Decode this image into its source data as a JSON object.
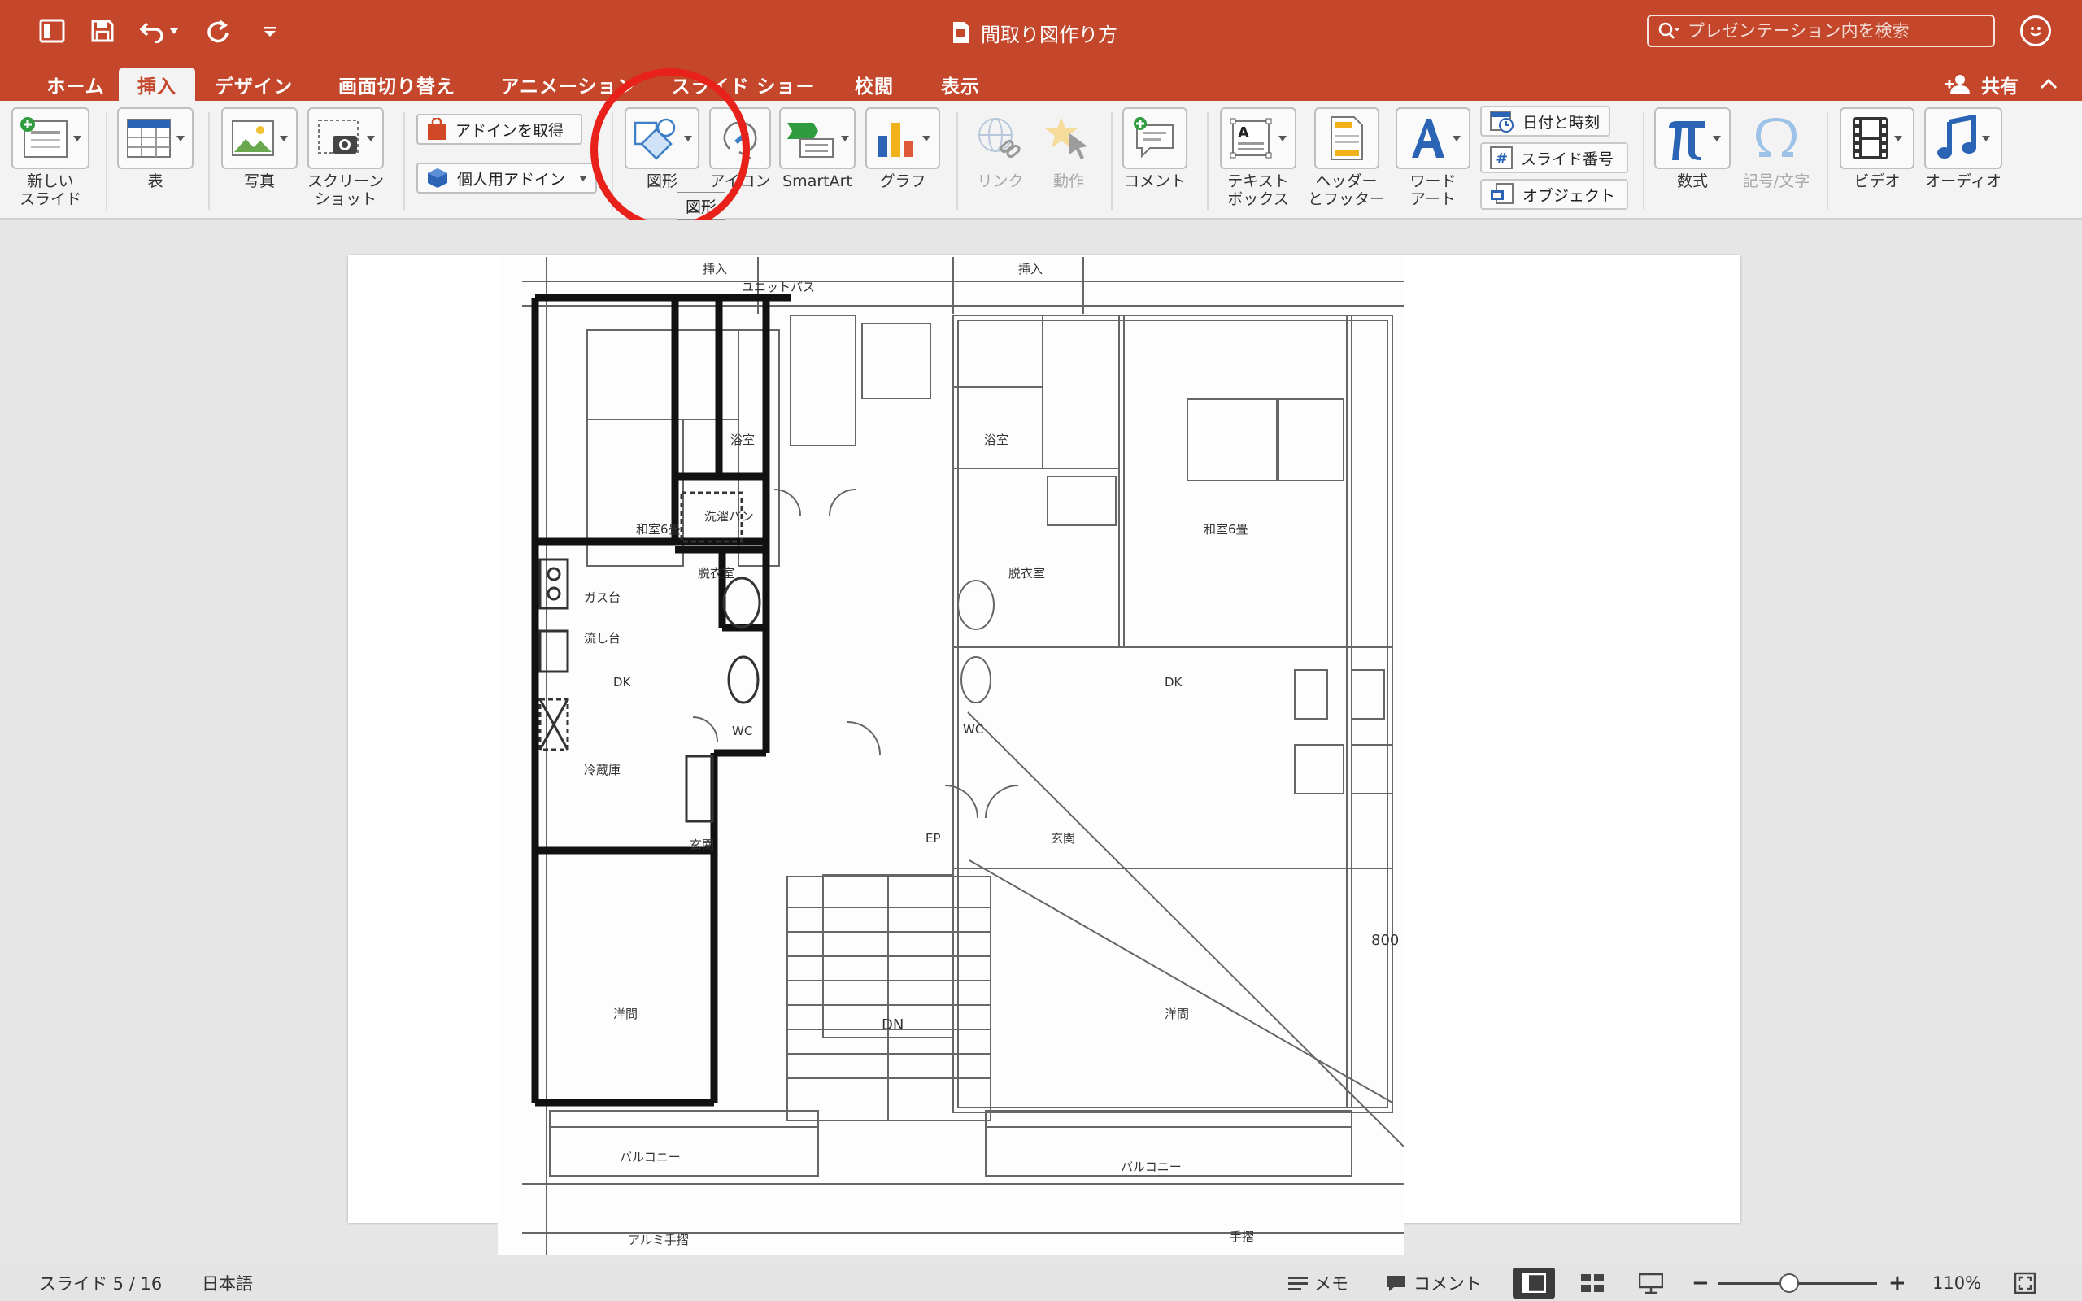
{
  "window": {
    "title": "間取り図作り方",
    "search_placeholder": "プレゼンテーション内を検索"
  },
  "toolbar_icons": [
    "sidebar-icon",
    "save-icon",
    "undo-icon",
    "redo-icon",
    "customize-icon"
  ],
  "tabs": [
    {
      "label": "ホーム",
      "active": false
    },
    {
      "label": "挿入",
      "active": true
    },
    {
      "label": "デザイン",
      "active": false
    },
    {
      "label": "画面切り替え",
      "active": false
    },
    {
      "label": "アニメーション",
      "active": false
    },
    {
      "label": "スライド ショー",
      "active": false
    },
    {
      "label": "校閲",
      "active": false
    },
    {
      "label": "表示",
      "active": false
    }
  ],
  "share_label": "共有",
  "ribbon": {
    "new_slide": "新しい\nスライド",
    "table": "表",
    "picture": "写真",
    "screenshot": "スクリーン\nショット",
    "get_addins": "アドインを取得",
    "my_addins": "個人用アドイン",
    "shapes": "図形",
    "icons": "アイコン",
    "smartart": "SmartArt",
    "chart": "グラフ",
    "link": "リンク",
    "action": "動作",
    "comment": "コメント",
    "textbox": "テキスト\nボックス",
    "header_footer": "ヘッダー\nとフッター",
    "wordart": "ワード\nアート",
    "date_time": "日付と時刻",
    "slide_number": "スライド番号",
    "object": "オブジェクト",
    "equation": "数式",
    "symbol": "記号/文字",
    "video": "ビデオ",
    "audio": "オーディオ"
  },
  "tooltip": "図形",
  "floorplan": {
    "labels": {
      "kitchen_left": "DK",
      "kitchen_right": "DK",
      "western_left": "洋間",
      "western_right": "洋間",
      "bath_left": "浴室",
      "bath_right": "浴室",
      "dressing_left": "脱衣室",
      "dressing_right": "脱衣室",
      "wc_left": "WC",
      "wc_right": "WC",
      "japanese_left": "和室6畳",
      "japanese_right": "和室6畳",
      "gas": "ガス台",
      "sink": "流し台",
      "fridge": "冷蔵庫",
      "entrance_left": "玄関",
      "entrance_right": "玄関",
      "washer_pan": "洗濯パン",
      "balcony_left": "バルコニー",
      "balcony_right": "バルコニー",
      "unit_bath": "ユニットバス",
      "insert_top_left": "挿入",
      "insert_top_right": "挿入",
      "dn": "DN",
      "hall": "EP",
      "dim_800": "800",
      "aluminum": "アルミ手摺",
      "handrail": "手摺"
    }
  },
  "status": {
    "slide_info": "スライド 5 / 16",
    "language": "日本語",
    "notes": "メモ",
    "comments": "コメント",
    "zoom": "110%",
    "zoom_level_fraction": 0.45
  },
  "colors": {
    "accent": "#c4472b",
    "annotation_circle": "#e8221b"
  }
}
